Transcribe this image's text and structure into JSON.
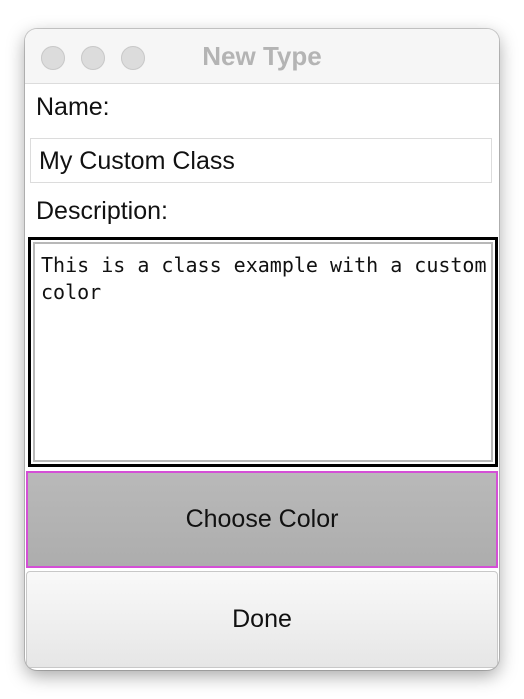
{
  "window": {
    "title": "New Type"
  },
  "form": {
    "name_label": "Name:",
    "name_value": "My Custom Class",
    "description_label": "Description:",
    "description_value": "This is a class example with a custom color"
  },
  "buttons": {
    "choose_color_label": "Choose Color",
    "done_label": "Done"
  },
  "colors": {
    "focus_highlight": "#d44fd6",
    "pressed_button_bg": "#b3b3b3",
    "title_text": "#b4b4b4"
  }
}
